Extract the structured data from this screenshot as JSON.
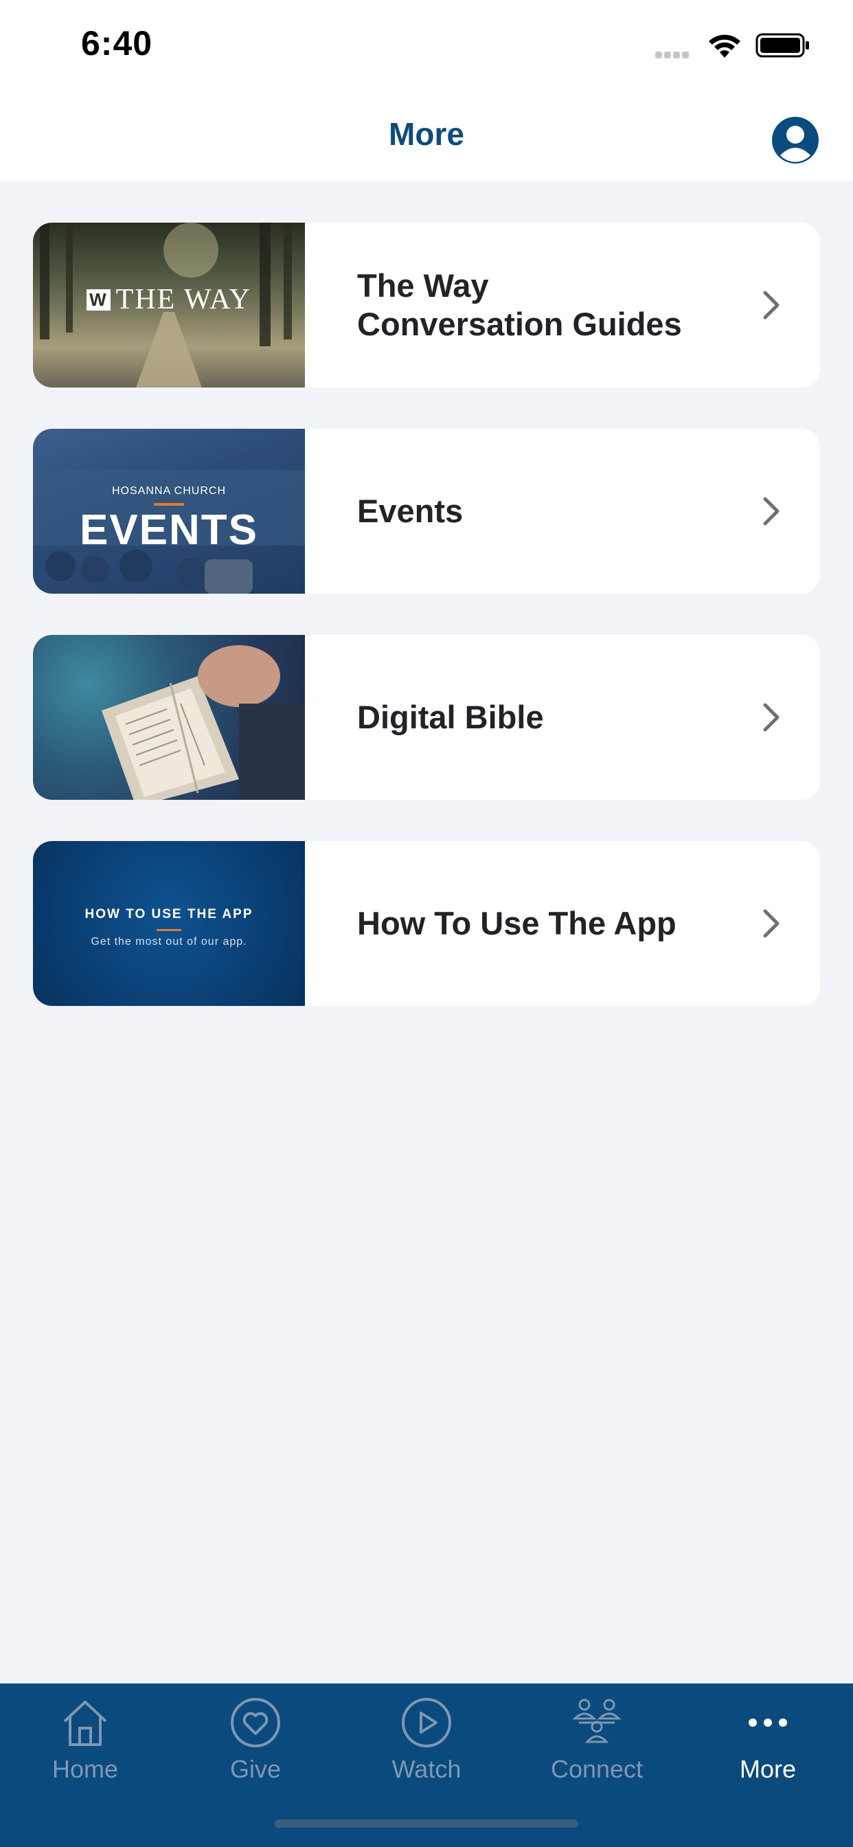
{
  "status_bar": {
    "time": "6:40"
  },
  "header": {
    "title": "More"
  },
  "cards": [
    {
      "label": "The Way Conversation Guides",
      "label_line1": "The Way",
      "label_line2": "Conversation Guides",
      "thumb_text": "THE WAY",
      "thumb_logo": "W"
    },
    {
      "label": "Events",
      "thumb_kicker": "HOSANNA CHURCH",
      "thumb_title": "EVENTS"
    },
    {
      "label": "Digital Bible"
    },
    {
      "label": "How To Use The App",
      "thumb_title": "HOW TO USE THE APP",
      "thumb_subtitle": "Get the most out of our app."
    }
  ],
  "tabs": [
    {
      "label": "Home",
      "icon": "home-icon"
    },
    {
      "label": "Give",
      "icon": "heart-icon"
    },
    {
      "label": "Watch",
      "icon": "play-icon"
    },
    {
      "label": "Connect",
      "icon": "people-icon"
    },
    {
      "label": "More",
      "icon": "more-dots-icon",
      "active": true
    }
  ],
  "colors": {
    "brand": "#0b4c7e",
    "tabbar": "#0b4a7c",
    "background": "#f2f3f8",
    "accent": "#e27a2d"
  }
}
